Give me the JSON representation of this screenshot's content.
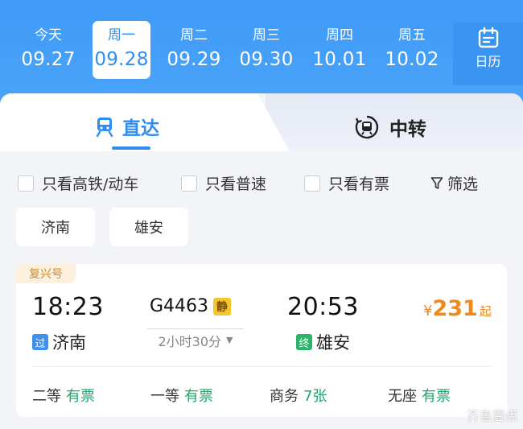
{
  "date_bar": {
    "days": [
      {
        "weekday": "今天",
        "date": "09.27"
      },
      {
        "weekday": "周一",
        "date": "09.28"
      },
      {
        "weekday": "周二",
        "date": "09.29"
      },
      {
        "weekday": "周三",
        "date": "09.30"
      },
      {
        "weekday": "周四",
        "date": "10.01"
      },
      {
        "weekday": "周五",
        "date": "10.02"
      }
    ],
    "selected_index": 1,
    "calendar_label": "日历"
  },
  "tabs": {
    "direct": "直达",
    "transfer": "中转"
  },
  "filters": {
    "high_speed_only": "只看高铁/动车",
    "normal_only": "只看普速",
    "available_only": "只看有票",
    "filter_label": "筛选"
  },
  "stations": {
    "from": "济南",
    "to": "雄安"
  },
  "train": {
    "tag": "复兴号",
    "departure_time": "18:23",
    "arrival_time": "20:53",
    "train_number": "G4463",
    "silent_badge": "静",
    "duration": "2小时30分",
    "from_badge": "过",
    "from_station": "济南",
    "to_badge": "终",
    "to_station": "雄安",
    "price_symbol": "¥",
    "price": "231",
    "price_suffix": "起",
    "seats": [
      {
        "class": "二等",
        "status": "有票"
      },
      {
        "class": "一等",
        "status": "有票"
      },
      {
        "class": "商务",
        "status": "7张"
      },
      {
        "class": "无座",
        "status": "有票"
      }
    ]
  },
  "watermark": "齐鲁壹点",
  "colors": {
    "primary": "#2f8cf0",
    "price": "#f08a1c",
    "available": "#20a56a",
    "tag_bg": "#fdf0dd"
  }
}
